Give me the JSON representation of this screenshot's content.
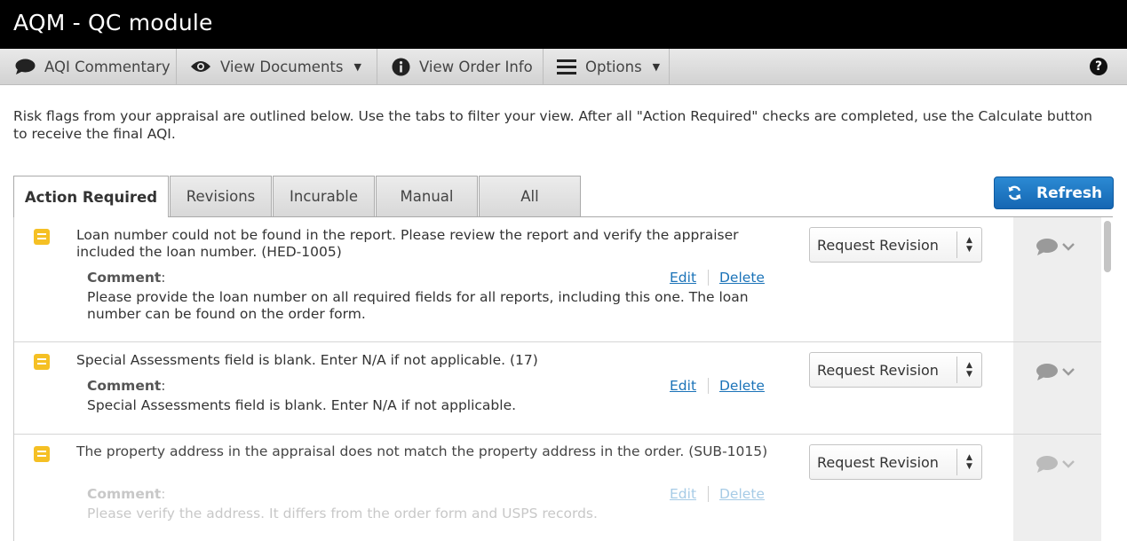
{
  "app": {
    "title": "AQM - QC module"
  },
  "toolbar": {
    "commentary": {
      "label": "AQI Commentary",
      "icon": "speech-bubble-icon"
    },
    "view_documents": {
      "label": "View Documents",
      "icon": "eye-icon"
    },
    "view_order_info": {
      "label": "View Order Info",
      "icon": "info-icon"
    },
    "options": {
      "label": "Options",
      "icon": "hamburger-menu-icon"
    },
    "help": {
      "label": "?",
      "icon": "help-icon"
    }
  },
  "intro": "Risk flags from your appraisal are outlined below. Use the tabs to filter your view. After all \"Action Required\" checks are completed, use the Calculate button to receive the final AQI.",
  "tabs": [
    {
      "label": "Action Required",
      "active": true
    },
    {
      "label": "Revisions",
      "active": false
    },
    {
      "label": "Incurable",
      "active": false
    },
    {
      "label": "Manual",
      "active": false
    },
    {
      "label": "All",
      "active": false
    }
  ],
  "refresh": {
    "label": "Refresh",
    "icon": "refresh-icon",
    "color": "#1e77c4"
  },
  "comment_label": "Comment",
  "edit_label": "Edit",
  "delete_label": "Delete",
  "flag_color": "#f5c024",
  "link_color": "#1b73b8",
  "rows": [
    {
      "message": "Loan number could not be found in the report. Please review the report and verify the appraiser included the loan number. (HED-1005)",
      "comment": "Please provide the loan number on all required fields for all reports, including this one. The loan number can be found on the order form.",
      "action": "Request Revision"
    },
    {
      "message": "Special Assessments field is blank. Enter N/A if not applicable. (17)",
      "comment": "Special Assessments field is blank. Enter N/A if not applicable.",
      "action": "Request Revision"
    },
    {
      "message": "The property address in the appraisal does not match the property address in the order. (SUB-1015)",
      "comment": "Please verify the address. It differs from the order form and USPS records.",
      "action": "Request Revision"
    }
  ]
}
